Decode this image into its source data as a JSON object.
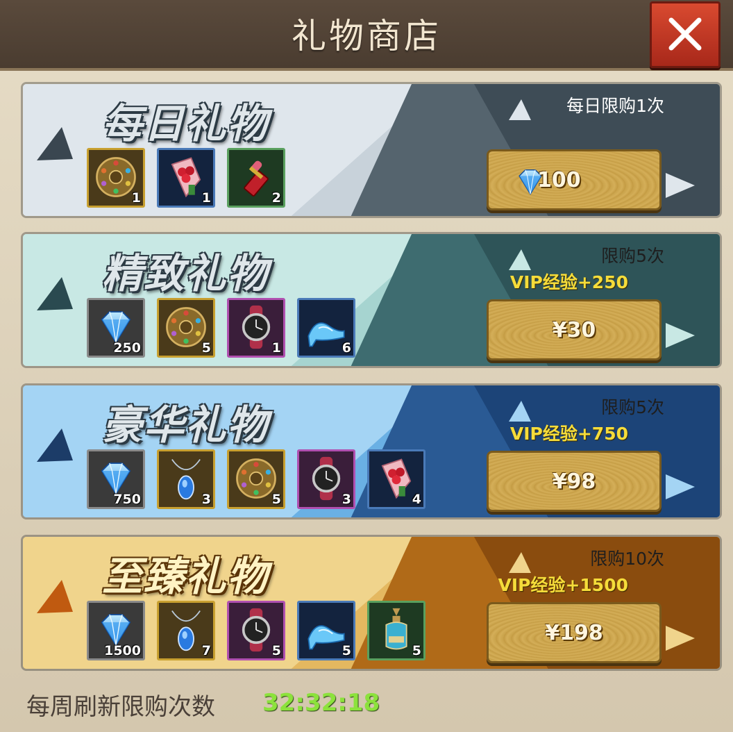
{
  "window": {
    "title": "礼物商店"
  },
  "colors": {
    "accent_gold": "#c9a24a",
    "timer_green": "#8ce23c",
    "vip_yellow": "#f5dc3a",
    "close_red": "#c43a24"
  },
  "packs": [
    {
      "title": "每日礼物",
      "limit": "每日限购1次",
      "vip": "",
      "price": "100",
      "price_icon": "diamond-icon",
      "items": [
        {
          "icon": "compass-disc-icon",
          "count": "1"
        },
        {
          "icon": "rose-bouquet-icon",
          "count": "1"
        },
        {
          "icon": "lipstick-icon",
          "count": "2"
        }
      ]
    },
    {
      "title": "精致礼物",
      "limit": "限购5次",
      "vip": "VIP经验+250",
      "price": "¥30",
      "items": [
        {
          "icon": "diamond-icon",
          "count": "250"
        },
        {
          "icon": "compass-disc-icon",
          "count": "5"
        },
        {
          "icon": "wristwatch-icon",
          "count": "1"
        },
        {
          "icon": "glass-slipper-icon",
          "count": "6"
        }
      ]
    },
    {
      "title": "豪华礼物",
      "limit": "限购5次",
      "vip": "VIP经验+750",
      "price": "¥98",
      "items": [
        {
          "icon": "diamond-icon",
          "count": "750"
        },
        {
          "icon": "pendant-necklace-icon",
          "count": "3"
        },
        {
          "icon": "compass-disc-icon",
          "count": "5"
        },
        {
          "icon": "wristwatch-icon",
          "count": "3"
        },
        {
          "icon": "rose-bouquet-icon",
          "count": "4"
        }
      ]
    },
    {
      "title": "至臻礼物",
      "limit": "限购10次",
      "vip": "VIP经验+1500",
      "price": "¥198",
      "items": [
        {
          "icon": "diamond-icon",
          "count": "1500"
        },
        {
          "icon": "pendant-necklace-icon",
          "count": "7"
        },
        {
          "icon": "wristwatch-icon",
          "count": "5"
        },
        {
          "icon": "glass-slipper-icon",
          "count": "5"
        },
        {
          "icon": "perfume-bottle-icon",
          "count": "5"
        }
      ]
    }
  ],
  "footer": {
    "label": "每周刷新限购次数",
    "timer": "32:32:18"
  }
}
